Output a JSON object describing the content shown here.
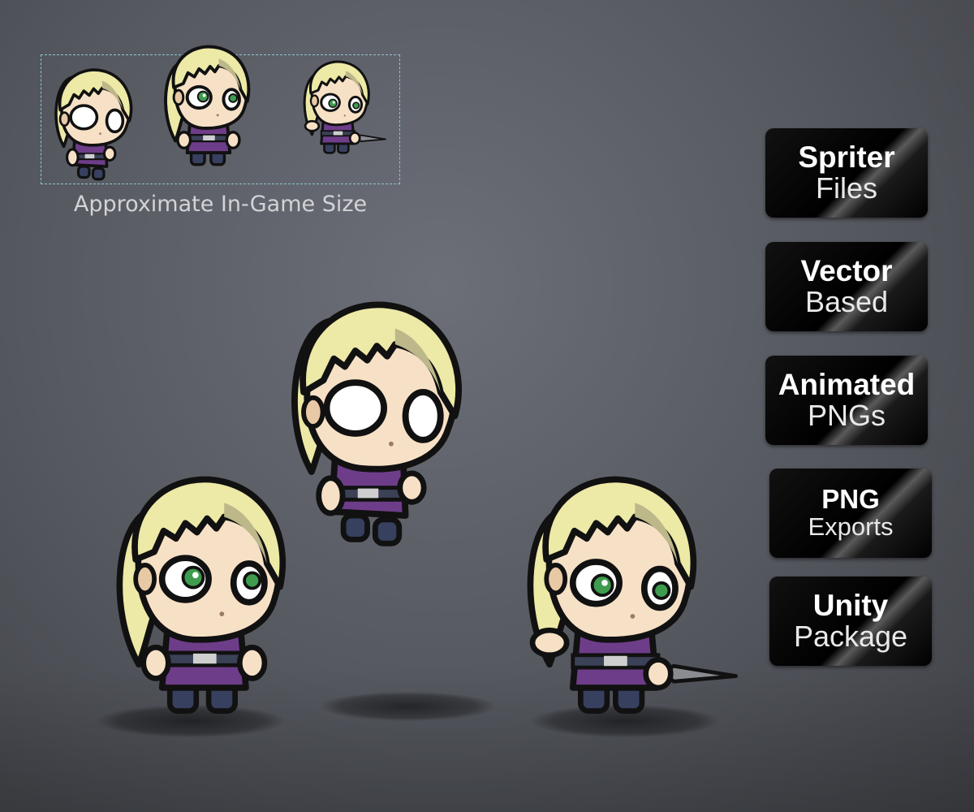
{
  "preview": {
    "caption": "Approximate In-Game Size"
  },
  "badges": [
    {
      "bold": "Spriter",
      "light": "Files"
    },
    {
      "bold": "Vector",
      "light": "Based"
    },
    {
      "bold": "Animated",
      "light": "PNGs"
    },
    {
      "bold": "PNG",
      "light": "Exports"
    },
    {
      "bold": "Unity",
      "light": "Package"
    }
  ],
  "colors": {
    "hair": "#ede9a6",
    "hair_shade": "#bdb88a",
    "skin": "#f7e1c6",
    "outfit": "#6e3d89",
    "eye": "#3f9c4e",
    "outline": "#111111"
  }
}
